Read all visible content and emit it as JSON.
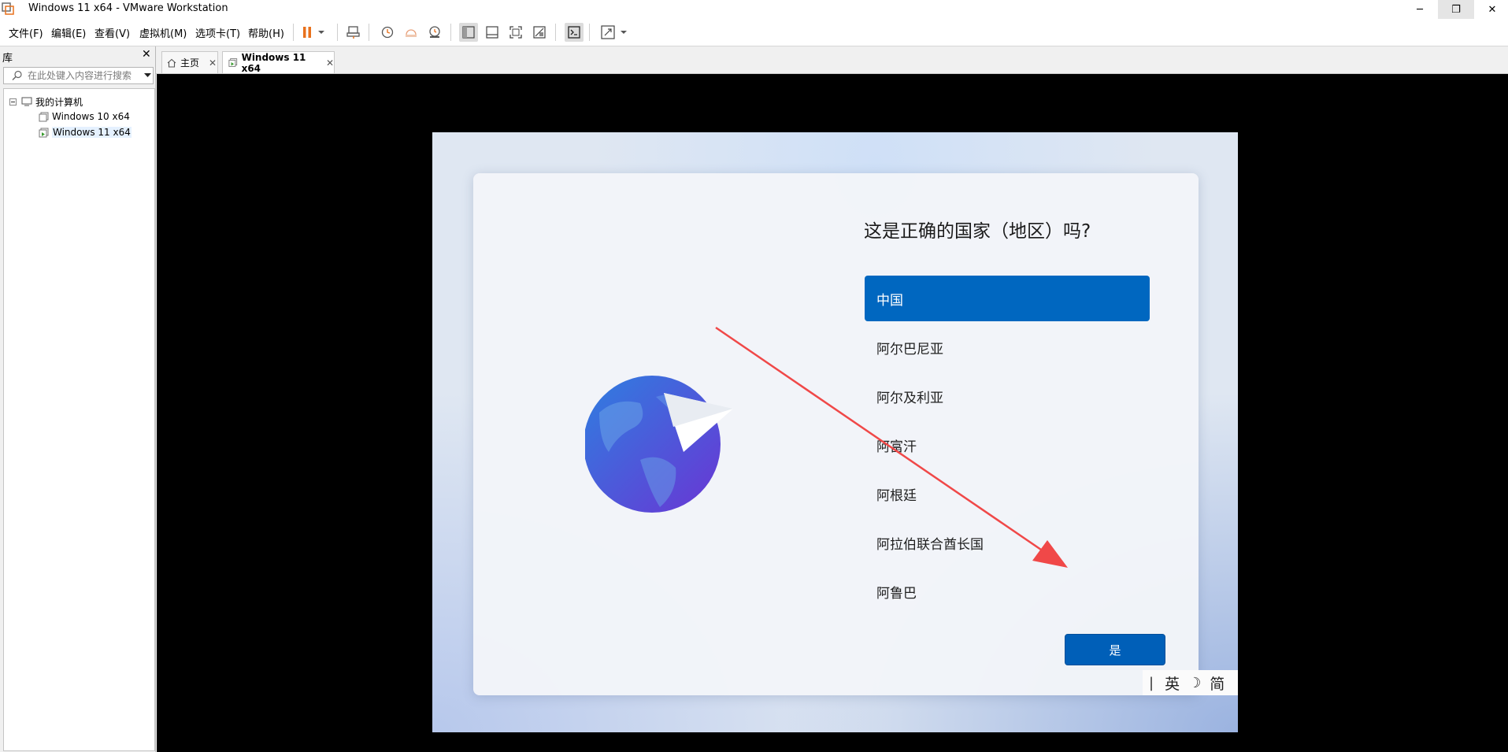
{
  "window": {
    "title": "Windows 11 x64 - VMware Workstation",
    "controls": {
      "minimize": "─",
      "maximize": "❐",
      "close": "✕"
    }
  },
  "menu": {
    "items": [
      "文件(F)",
      "编辑(E)",
      "查看(V)",
      "虚拟机(M)",
      "选项卡(T)",
      "帮助(H)"
    ]
  },
  "toolbar": {
    "icons": [
      "pause-icon",
      "dropdown-arrow-icon",
      "send-ctrl-alt-del-icon",
      "snapshot-icon",
      "revert-snapshot-icon",
      "snapshot-manager-icon",
      "library-view-icon",
      "thumbnail-bar-icon",
      "full-screen-icon",
      "unity-icon",
      "console-view-icon",
      "stretch-icon",
      "dropdown-arrow-icon"
    ],
    "accent": "#e8711c"
  },
  "library": {
    "header": "库",
    "close": "✕",
    "search_placeholder": "在此处键入内容进行搜索",
    "tree": {
      "root": "我的计算机",
      "vms": [
        "Windows 10 x64",
        "Windows 11 x64"
      ],
      "selected": "Windows 11 x64"
    }
  },
  "tabs": [
    {
      "label": "主页",
      "close": "✕",
      "active": false
    },
    {
      "label": "Windows 11 x64",
      "close": "✕",
      "active": true
    }
  ],
  "guest": {
    "title": "这是正确的国家（地区）吗?",
    "regions": [
      "中国",
      "阿尔巴尼亚",
      "阿尔及利亚",
      "阿富汗",
      "阿根廷",
      "阿拉伯联合酋长国",
      "阿鲁巴"
    ],
    "selected_region": "中国",
    "yes_button": "是",
    "ime": {
      "separator": "|",
      "mode": "英",
      "moon": "☽",
      "script": "简"
    },
    "accent": "#0067c0"
  },
  "annotation": {
    "arrow_color": "#f04848"
  }
}
